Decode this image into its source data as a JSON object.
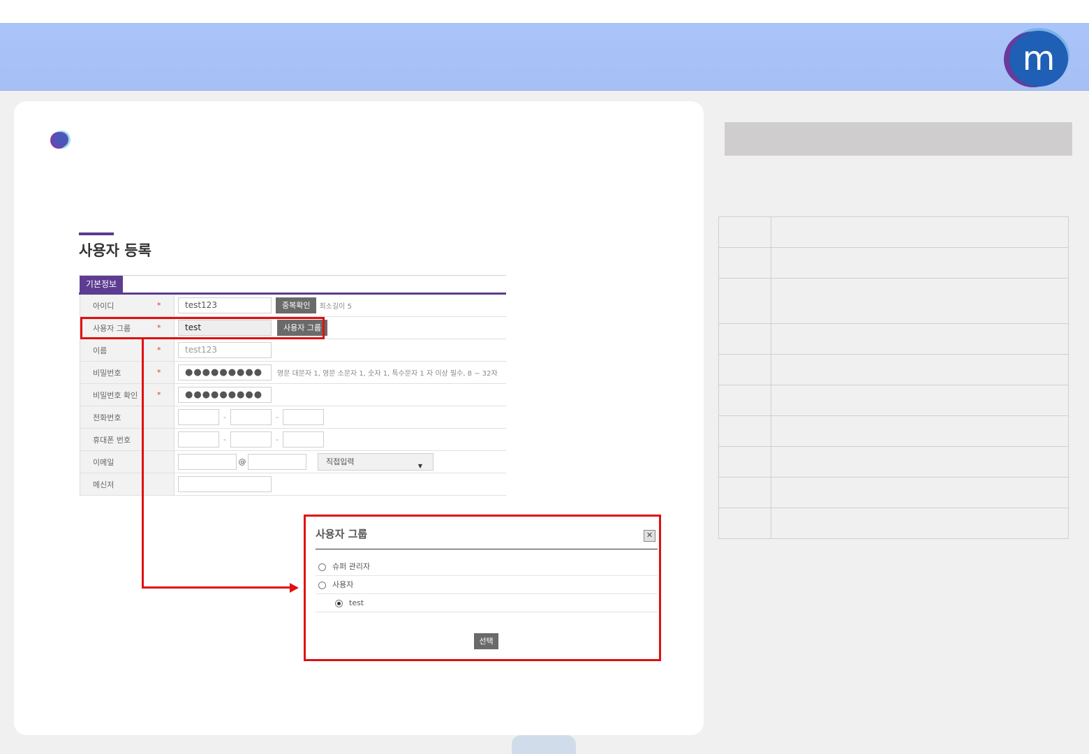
{
  "page": {
    "title": "사용자 등록",
    "tab_label": "기본정보"
  },
  "form": {
    "rows": [
      {
        "label": "아이디",
        "required": "*",
        "value": "test123",
        "button": "중복확인",
        "hint": "최소길이 5"
      },
      {
        "label": "사용자 그룹",
        "required": "*",
        "value": "test",
        "button": "사용자 그룹"
      },
      {
        "label": "이름",
        "required": "*",
        "value": "test123"
      },
      {
        "label": "비밀번호",
        "required": "*",
        "value": "●●●●●●●●●",
        "hint": "영문 대문자 1, 영문 소문자 1, 숫자 1, 특수문자 1 자 이상 필수, 8 ~ 32자"
      },
      {
        "label": "비밀번호 확인",
        "required": "*",
        "value": "●●●●●●●●●"
      },
      {
        "label": "전화번호",
        "separator": "-"
      },
      {
        "label": "휴대폰 번호",
        "separator": "-"
      },
      {
        "label": "이메일",
        "at": "@",
        "select": "직접입력"
      },
      {
        "label": "메신저"
      }
    ]
  },
  "popup": {
    "title": "사용자 그룹",
    "close_icon": "✕",
    "options": [
      {
        "label": "슈퍼 관리자",
        "selected": false
      },
      {
        "label": "사용자",
        "selected": false
      },
      {
        "label": "test",
        "selected": true
      }
    ],
    "select_button": "선택"
  },
  "colors": {
    "header": "#a8c2f8",
    "accent_purple": "#5d3c91",
    "highlight_red": "#e01010"
  }
}
